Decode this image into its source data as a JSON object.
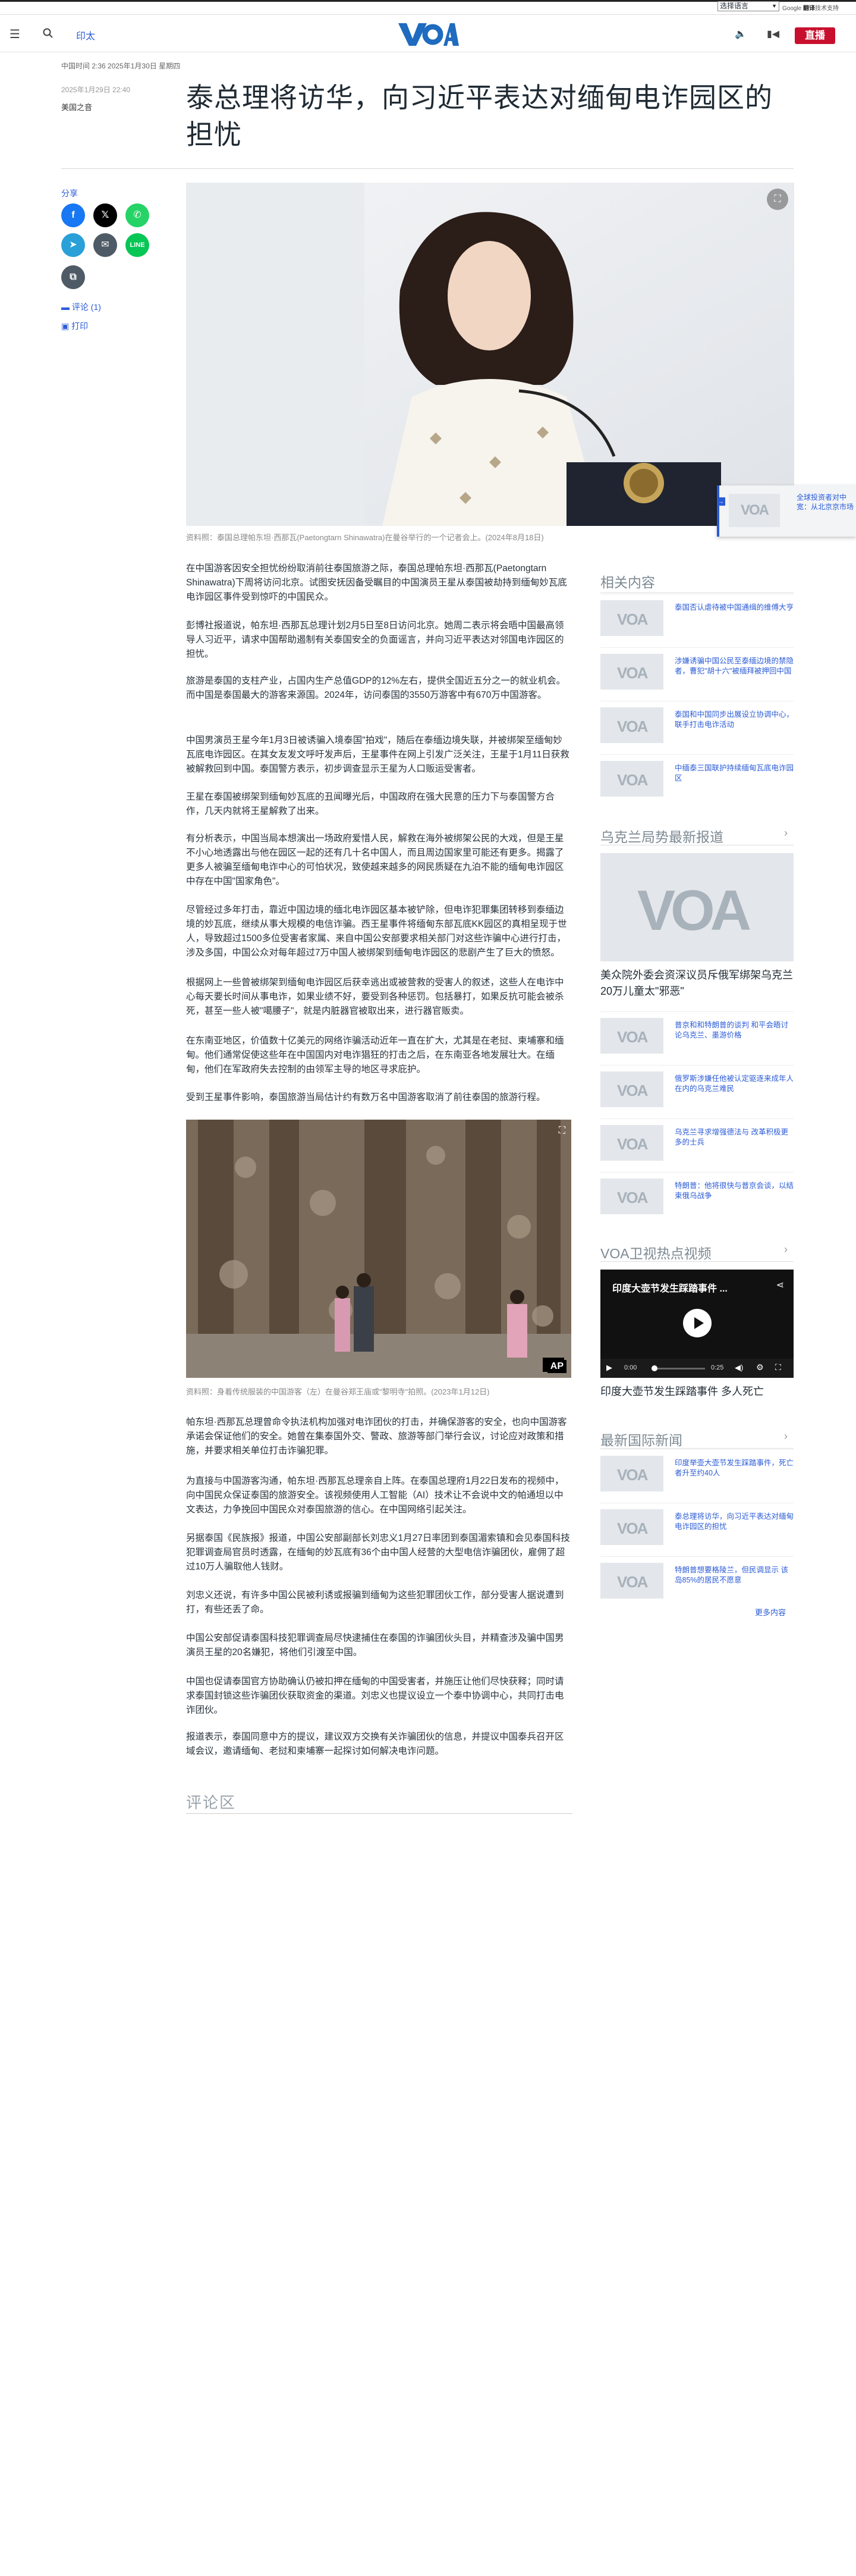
{
  "topbar": {
    "language_select": "选择语言",
    "google_play_pre": "Google",
    "google_play_label": "翻译",
    "google_play_post": "技术支持"
  },
  "header": {
    "section": "印太",
    "live_label": "直播"
  },
  "article": {
    "dateline": "中国时间 2:36 2025年1月30日 星期四",
    "published": "2025年1月29日 22:40",
    "byline": "美国之音",
    "title": "泰总理将访华，向习近平表达对缅甸电诈园区的担忧",
    "hero_caption": "资料照：泰国总理帕东坦·西那瓦(Paetongtarn Shinawatra)在曼谷举行的一个记者会上。(2024年8月18日)",
    "paragraphs": [
      "在中国游客因安全担忧纷纷取消前往泰国旅游之际，泰国总理帕东坦·西那瓦(Paetongtarn Shinawatra)下周将访问北京。试图安抚因备受瞩目的中国演员王星从泰国被劫持到缅甸妙瓦底电诈园区事件受到惊吓的中国民众。",
      "彭博社报道说，帕东坦·西那瓦总理计划2月5日至8日访问北京。她周二表示将会晤中国最高领导人习近平，请求中国帮助遏制有关泰国安全的负面谣言，并向习近平表达对邻国电诈园区的担忧。",
      "旅游是泰国的支柱产业，占国内生产总值GDP的12%左右，提供全国近五分之一的就业机会。而中国是泰国最大的游客来源国。2024年，访问泰国的3550万游客中有670万中国游客。",
      "中国男演员王星今年1月3日被诱骗入境泰国\"拍戏\"，随后在泰缅边境失联，并被绑架至缅甸妙瓦底电诈园区。在其女友发文呼吁发声后，王星事件在网上引发广泛关注，王星于1月11日获救被解救回到中国。泰国警方表示，初步调查显示王星为人口贩运受害者。",
      "王星在泰国被绑架到缅甸妙瓦底的丑闻曝光后，中国政府在强大民意的压力下与泰国警方合作，几天内就将王星解救了出来。",
      "有分析表示，中国当局本想演出一场政府爱惜人民，解救在海外被绑架公民的大戏，但是王星不小心地透露出与他在园区一起的还有几十名中国人，而且周边国家里可能还有更多。揭露了更多人被骗至缅甸电诈中心的可怕状况，致使越来越多的网民质疑在九泊不能的缅甸电诈园区中存在中国\"国家角色\"。",
      "尽管经过多年打击，靠近中国边境的缅北电诈园区基本被铲除，但电诈犯罪集团转移到泰缅边境的妙瓦底，继续从事大规模的电信诈骗。西王星事件将缅甸东部瓦底KK园区的真相呈现于世人，导致超过1500多位受害者家属、来自中国公安部要求相关部门对这些诈骗中心进行打击，涉及多国，中国公众对每年超过7万中国人被绑架到缅甸电诈园区的悲剧产生了巨大的愤怒。",
      "根据网上一些曾被绑架到缅甸电诈园区后获幸逃出或被营救的受害人的叙述，这些人在电诈中心每天要长时间从事电诈，如果业绩不好，要受到各种惩罚。包括暴打，如果反抗可能会被杀死，甚至一些人被\"噶腰子\"，就是内脏器官被取出来，进行器官贩卖。",
      "在东南亚地区，价值数十亿美元的网络诈骗活动近年一直在扩大，尤其是在老挝、柬埔寨和缅甸。他们通常促使这些年在中国国内对电诈猖狂的打击之后，在东南亚各地发展壮大。在缅甸，他们在军政府失去控制的由领军主导的地区寻求庇护。",
      "受到王星事件影响，泰国旅游当局估计约有数万名中国游客取消了前往泰国的旅游行程。"
    ],
    "img2_caption": "资料照：身着传统服装的中国游客（左）在曼谷郑王庙或\"黎明寺\"拍照。(2023年1月12日)",
    "paragraphs2": [
      "帕东坦·西那瓦总理曾命令执法机构加强对电诈团伙的打击，并确保游客的安全，也向中国游客承诺会保证他们的安全。她曾在集泰国外交、警政、旅游等部门举行会议，讨论应对政策和措施，并要求相关单位打击诈骗犯罪。",
      "为直接与中国游客沟通，帕东坦·西那瓦总理亲自上阵。在泰国总理府1月22日发布的视频中，向中国民众保证泰国的旅游安全。该视频使用人工智能（AI）技术让不会说中文的帕通坦以中文表达，力争挽回中国民众对泰国旅游的信心。在中国网络引起关注。",
      "另据泰国《民族报》报道，中国公安部副部长刘忠义1月27日率团到泰国湄索镇和会见泰国科技犯罪调查局官员时透露，在缅甸的妙瓦底有36个由中国人经营的大型电信诈骗团伙，雇佣了超过10万人骗取他人钱财。",
      "刘忠义还说，有许多中国公民被利诱或报骗到缅甸为这些犯罪团伙工作，部分受害人据说遭到打，有些还丢了命。",
      "中国公安部促请泰国科技犯罪调查局尽快逮捕住在泰国的诈骗团伙头目，并精查涉及骗中国男演员王星的20名嫌犯，将他们引渡至中国。",
      "中国也促请泰国官方协助确认仍被扣押在缅甸的中国受害者，并施压让他们尽快获释；同时请求泰国封锁这些诈骗团伙获取资金的渠道。刘忠义也提议设立一个泰中协调中心，共同打击电诈团伙。",
      "报道表示，泰国同意中方的提议，建议双方交换有关诈骗团伙的信息，并提议中国泰兵召开区域会议，邀请缅甸、老挝和柬埔寨一起探讨如何解决电诈问题。"
    ],
    "comments_title": "评论区"
  },
  "share": {
    "label": "分享",
    "comments_link": "评论 (1)",
    "print_link": "打印"
  },
  "floating": {
    "text": "全球投资者对中宽：从北京京市场"
  },
  "sidebar": {
    "related_title": "相关内容",
    "related": [
      "泰国否认虐待被中国通缉的维傅大亨",
      "涉嫌诱骗中国公民至泰缅边境的禁隐者，曹犯\"胡十六\"被缅拜被押回中国",
      "泰国和中国同步出展设立协调中心，联手打击电诈活动",
      "中缅泰三国联护持续缅甸瓦底电诈园区"
    ],
    "ukraine_title": "乌克兰局势最新报道",
    "ukraine_feature": "美众院外委会资深议员斥俄军绑架乌克兰20万儿童太\"邪恶\"",
    "ukraine": [
      "普京和和特朗普的谈判 和平会晤讨论乌克兰、墨游价格",
      "俄罗斯涉嫌任他被认定驱逐来成年人在内的乌克兰难民",
      "乌克兰寻求增强德法与 改革积极更多的士兵",
      "特朗普：他将很快与普京会谈，以结束俄乌战争"
    ],
    "video_title": "VOA卫视热点视频",
    "video_overlay": "印度大壶节发生踩踏事件 ...",
    "video_time_now": "0:00",
    "video_time_total": "0:25",
    "video_caption": "印度大壶节发生踩踏事件 多人死亡",
    "intl_title": "最新国际新闻",
    "intl": [
      "印度举壶大壶节发生踩踏事件，死亡者升至约40人",
      "泰总理将访华，向习近平表达对缅甸电诈园区的担忧",
      "特朗普想要格陵兰，但民调显示 该岛85%的居民不愿意"
    ],
    "more_label": "更多内容"
  },
  "colors": {
    "brand_blue": "#2a5bd7",
    "live_red": "#c8102e"
  }
}
